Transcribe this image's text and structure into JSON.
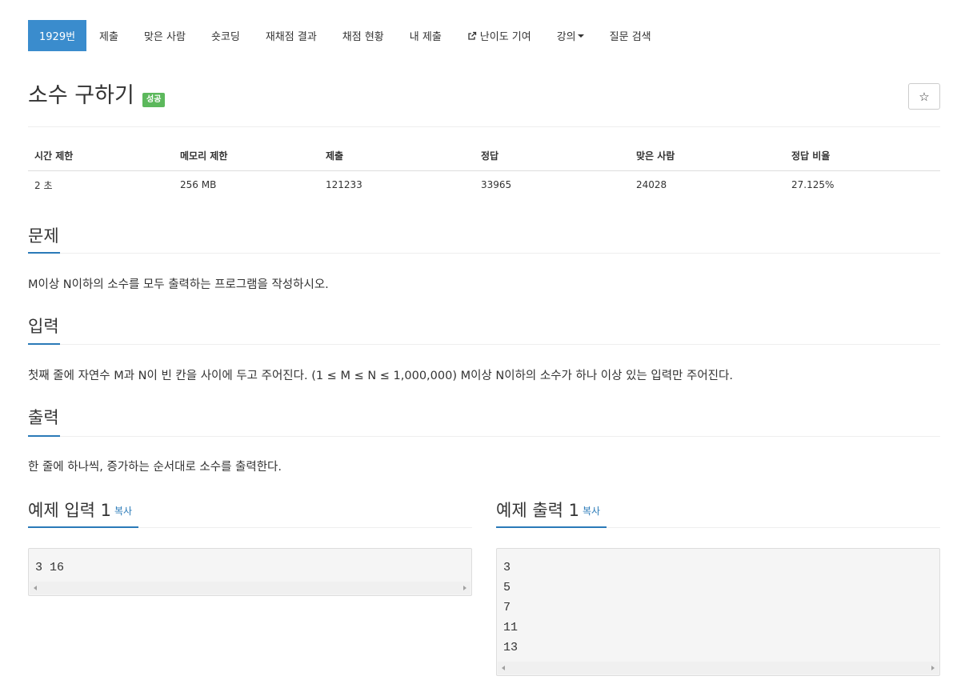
{
  "nav": {
    "items": [
      {
        "label": "1929번",
        "active": true
      },
      {
        "label": "제출"
      },
      {
        "label": "맞은 사람"
      },
      {
        "label": "숏코딩"
      },
      {
        "label": "재채점 결과"
      },
      {
        "label": "채점 현황"
      },
      {
        "label": "내 제출"
      },
      {
        "label": "난이도 기여",
        "icon": "external-link-icon"
      },
      {
        "label": "강의",
        "icon": "caret-down-icon"
      },
      {
        "label": "질문 검색"
      }
    ]
  },
  "problem": {
    "title": "소수 구하기",
    "status_badge": "성공",
    "star_icon": "☆"
  },
  "info_table": {
    "headers": [
      "시간 제한",
      "메모리 제한",
      "제출",
      "정답",
      "맞은 사람",
      "정답 비율"
    ],
    "values": [
      "2 초",
      "256 MB",
      "121233",
      "33965",
      "24028",
      "27.125%"
    ]
  },
  "sections": {
    "description": {
      "heading": "문제",
      "text": "M이상 N이하의 소수를 모두 출력하는 프로그램을 작성하시오."
    },
    "input": {
      "heading": "입력",
      "text": "첫째 줄에 자연수 M과 N이 빈 칸을 사이에 두고 주어진다. (1 ≤ M ≤ N ≤ 1,000,000) M이상 N이하의 소수가 하나 이상 있는 입력만 주어진다."
    },
    "output": {
      "heading": "출력",
      "text": "한 줄에 하나씩, 증가하는 순서대로 소수를 출력한다."
    }
  },
  "examples": {
    "input": {
      "heading": "예제 입력 1",
      "copy_label": "복사",
      "lines": [
        "3 16"
      ]
    },
    "output": {
      "heading": "예제 출력 1",
      "copy_label": "복사",
      "lines": [
        "3",
        "5",
        "7",
        "11",
        "13"
      ]
    }
  },
  "colors": {
    "accent": "#3a8ccd",
    "success_badge": "#5cb85c",
    "link": "#2a7ab8"
  }
}
